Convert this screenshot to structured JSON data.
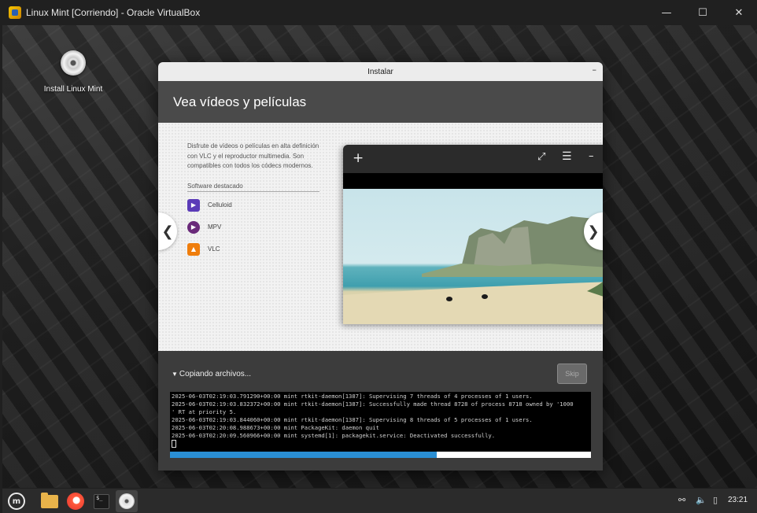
{
  "host_window": {
    "title": "Linux Mint [Corriendo] - Oracle VirtualBox",
    "controls": [
      "—",
      "☐",
      "✕"
    ]
  },
  "desktop": {
    "icon_label": "Install Linux Mint"
  },
  "installer": {
    "title": "Instalar",
    "minimize": "–",
    "slide_title": "Vea vídeos y películas",
    "description": "Disfrute de vídeos o películas en alta definición con VLC y el reproductor multimedia. Son compatibles con todos los códecs modernos.",
    "software_heading": "Software destacado",
    "software": [
      {
        "label": "Celluloid",
        "icon": "celluloid-icon",
        "color": "#5b3bb8"
      },
      {
        "label": "MPV",
        "icon": "mpv-icon",
        "color": "#6a2a7a"
      },
      {
        "label": "VLC",
        "icon": "vlc-icon",
        "color": "#ef7d0c"
      }
    ],
    "nav_prev": "❮",
    "nav_next": "❯",
    "player_icons": {
      "add": "+",
      "fullscreen": "⤢",
      "menu": "☰",
      "minimize": "–"
    },
    "progress_label": "Copiando archivos...",
    "skip_label": "Skip",
    "log_lines": [
      "2025-06-03T02:19:03.791290+00:00 mint rtkit-daemon[1387]: Supervising 7 threads of 4 processes of 1 users.",
      "2025-06-03T02:19:03.832372+00:00 mint rtkit-daemon[1387]: Successfully made thread 8728 of process 8718 owned by '1000",
      "' RT at priority 5.",
      "2025-06-03T02:19:03.844060+00:00 mint rtkit-daemon[1387]: Supervising 8 threads of 5 processes of 1 users.",
      "2025-06-03T02:20:08.988673+00:00 mint PackageKit: daemon quit",
      "2025-06-03T02:20:09.560966+00:00 mint systemd[1]: packagekit.service: Deactivated successfully."
    ],
    "progress_fraction": 0.633
  },
  "taskbar": {
    "clock": "23:21",
    "apps": [
      "mint-menu-icon",
      "files-icon",
      "firefox-icon",
      "terminal-icon",
      "installer-disc-icon"
    ]
  }
}
